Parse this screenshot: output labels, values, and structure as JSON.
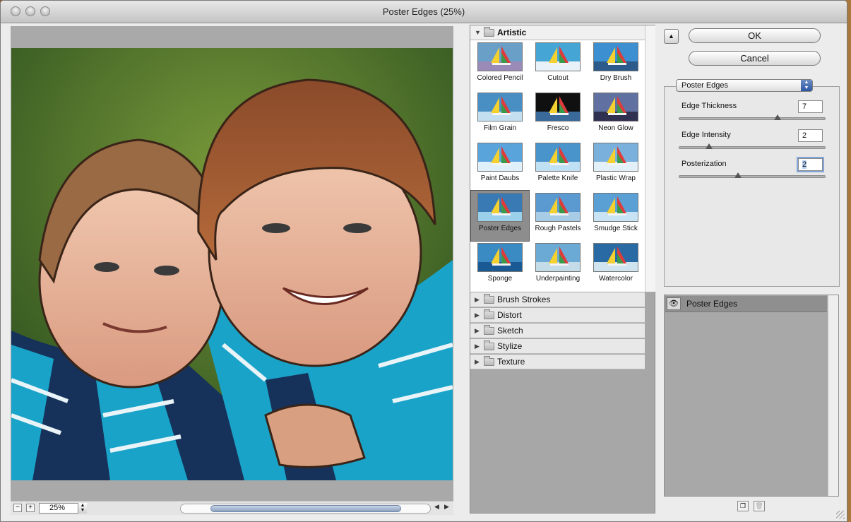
{
  "window": {
    "title": "Poster Edges (25%)"
  },
  "preview": {
    "zoom": "25%",
    "zoom_out": "−",
    "zoom_in": "+"
  },
  "gallery": {
    "open_category": "Artistic",
    "filters": [
      {
        "label": "Colored Pencil",
        "selected": false
      },
      {
        "label": "Cutout",
        "selected": false
      },
      {
        "label": "Dry Brush",
        "selected": false
      },
      {
        "label": "Film Grain",
        "selected": false
      },
      {
        "label": "Fresco",
        "selected": false
      },
      {
        "label": "Neon Glow",
        "selected": false
      },
      {
        "label": "Paint Daubs",
        "selected": false
      },
      {
        "label": "Palette Knife",
        "selected": false
      },
      {
        "label": "Plastic Wrap",
        "selected": false
      },
      {
        "label": "Poster Edges",
        "selected": true
      },
      {
        "label": "Rough Pastels",
        "selected": false
      },
      {
        "label": "Smudge Stick",
        "selected": false
      },
      {
        "label": "Sponge",
        "selected": false
      },
      {
        "label": "Underpainting",
        "selected": false
      },
      {
        "label": "Watercolor",
        "selected": false
      }
    ],
    "categories": [
      "Brush Strokes",
      "Distort",
      "Sketch",
      "Stylize",
      "Texture"
    ]
  },
  "actions": {
    "ok": "OK",
    "cancel": "Cancel"
  },
  "settings": {
    "filter_name": "Poster Edges",
    "params": [
      {
        "label": "Edge Thickness",
        "value": "7",
        "level": 0.67,
        "focused": false
      },
      {
        "label": "Edge Intensity",
        "value": "2",
        "level": 0.2,
        "focused": false
      },
      {
        "label": "Posterization",
        "value": "2",
        "level": 0.4,
        "focused": true
      }
    ]
  },
  "layers": {
    "items": [
      {
        "label": "Poster Edges"
      }
    ]
  },
  "colors": {
    "accent": "#2c56a5",
    "shirt": "#1aa3c8",
    "grass": "#3d6d2a",
    "selected_thumb": "#8d8d8d"
  },
  "icons": [
    "eye-icon",
    "new-layer-icon",
    "trash-icon",
    "collapse-icon",
    "folder-icon",
    "disclosure-triangle-icon"
  ]
}
